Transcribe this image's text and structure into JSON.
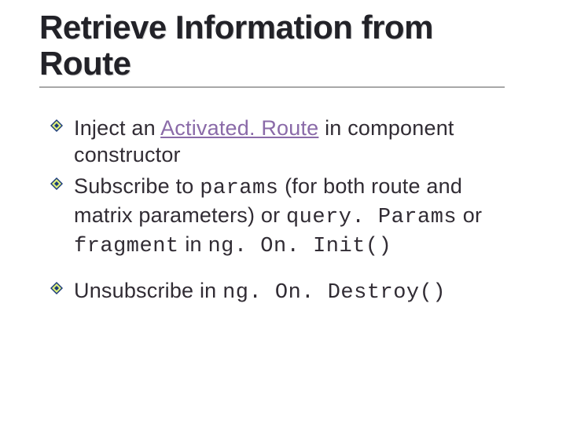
{
  "title_line1": "Retrieve Information from",
  "title_line2": "Route",
  "bullets": {
    "b1": {
      "pre": "Inject an ",
      "link": "Activated. Route",
      "post": " in component constructor"
    },
    "b2": {
      "pre": "Subscribe to ",
      "code1": "params",
      "mid1": " (for both route and matrix parameters) or ",
      "code2": "query. Params",
      "mid2": " or ",
      "code3": "fragment",
      "mid3": " in ",
      "code4": "ng. On. Init()"
    },
    "b3": {
      "pre": "Unsubscribe in ",
      "code1": "ng. On. Destroy()"
    }
  }
}
